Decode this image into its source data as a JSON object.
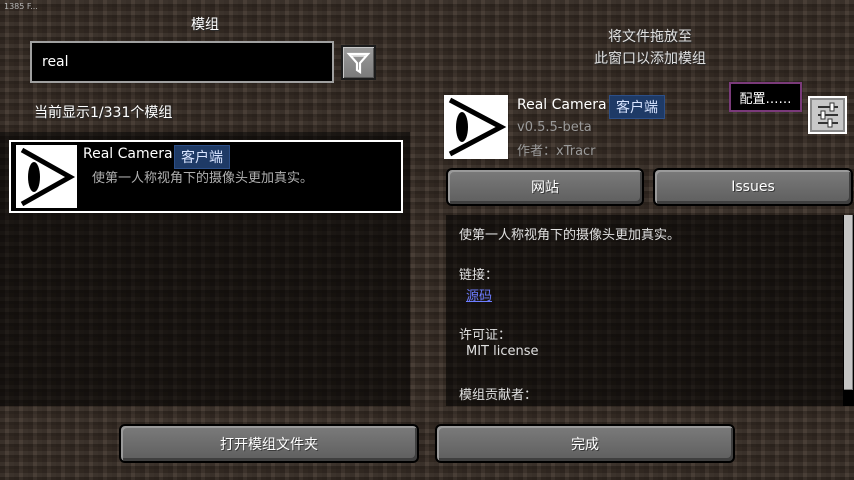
{
  "fps_text": "1385 F...",
  "header": {
    "title": "模组",
    "drop_hint_line1": "将文件拖放至",
    "drop_hint_line2": "此窗口以添加模组"
  },
  "search": {
    "value": "real",
    "filter_icon": "filter-icon"
  },
  "count_text": "当前显示1/331个模组",
  "mod_list": [
    {
      "name": "Real Camera",
      "tag": "客户端",
      "description": "使第一人称视角下的摄像头更加真实。",
      "icon": "eye-icon"
    }
  ],
  "details": {
    "name": "Real Camera",
    "tag": "客户端",
    "version": "v0.5.5-beta",
    "author": "作者：xTracr",
    "config_label": "配置……",
    "settings_icon": "sliders-icon",
    "website_label": "网站",
    "issues_label": "Issues",
    "description": "使第一人称视角下的摄像头更加真实。",
    "links_label": "链接：",
    "source_link": "源码",
    "license_label": "许可证：",
    "license_value": "MIT license",
    "contributors_label": "模组贡献者："
  },
  "footer": {
    "open_folder_label": "打开模组文件夹",
    "done_label": "完成"
  },
  "colors": {
    "tag_bg": "#1e3a66",
    "link": "#6c7cff",
    "config_border": "#7a3a7a"
  }
}
